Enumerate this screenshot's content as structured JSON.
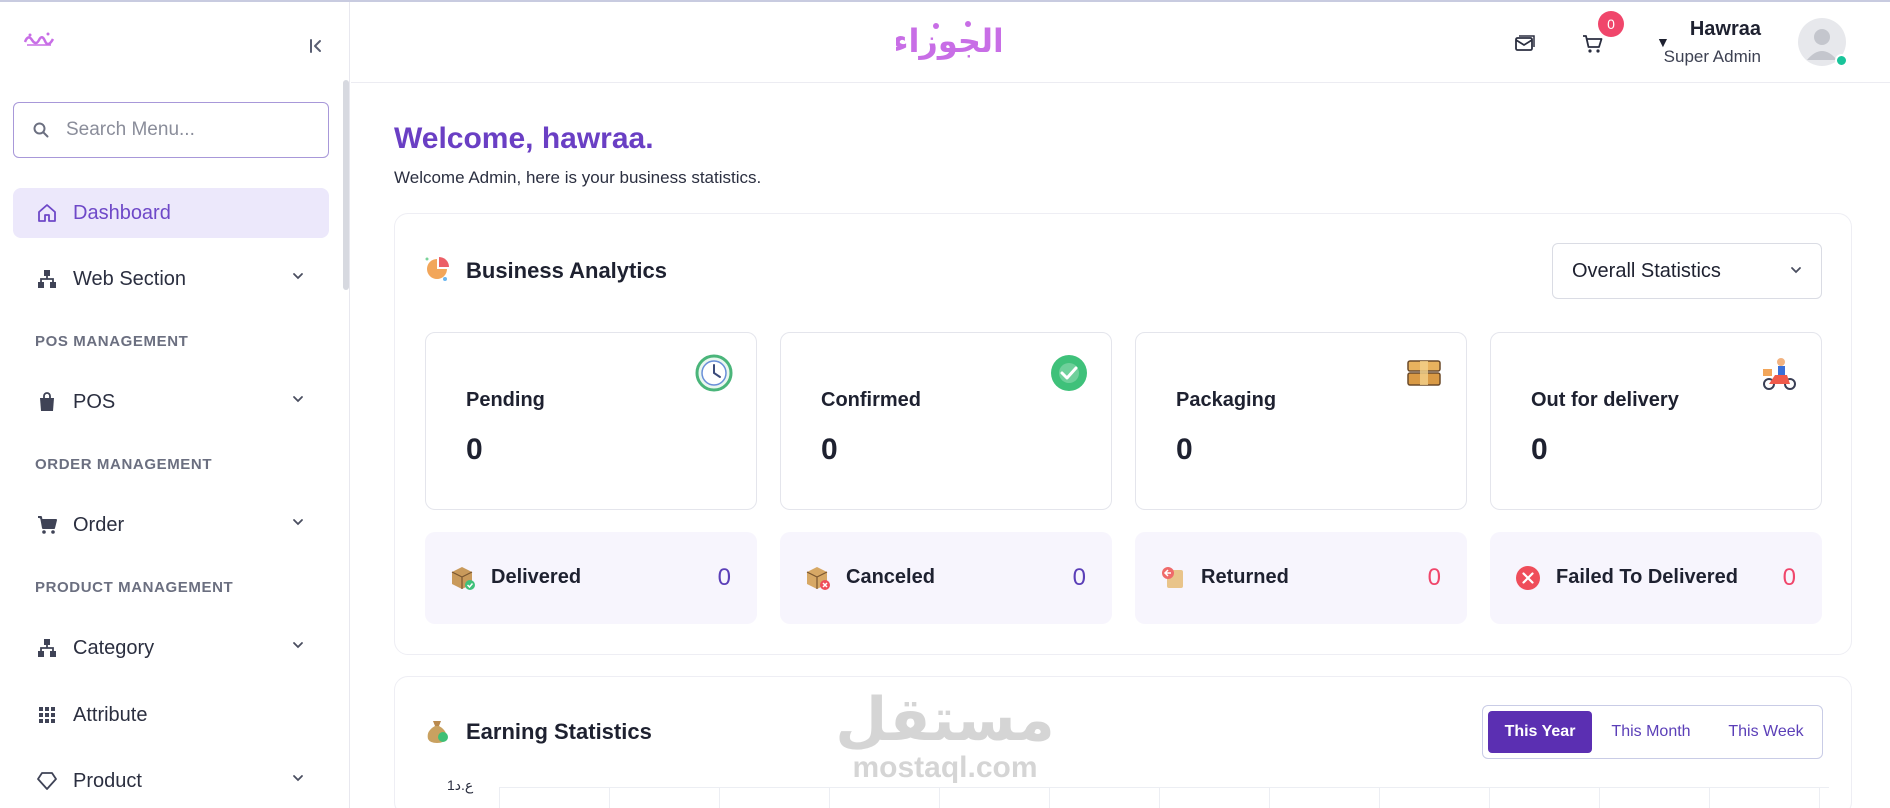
{
  "brand": {
    "logo_text": "الجوزاء",
    "logo_color": "#c86ee6"
  },
  "sidebar": {
    "search_placeholder": "Search Menu...",
    "items": [
      {
        "label": "Dashboard"
      },
      {
        "label": "Web Section"
      },
      {
        "label": "POS"
      },
      {
        "label": "Order"
      },
      {
        "label": "Category"
      },
      {
        "label": "Attribute"
      },
      {
        "label": "Product"
      }
    ],
    "sections": [
      "POS MANAGEMENT",
      "ORDER MANAGEMENT",
      "PRODUCT MANAGEMENT"
    ]
  },
  "header": {
    "cart_count": "0",
    "user_name": "Hawraa",
    "user_role": "Super Admin"
  },
  "welcome": {
    "title": "Welcome, hawraa.",
    "subtitle": "Welcome Admin, here is your business statistics."
  },
  "analytics": {
    "title": "Business Analytics",
    "filter_value": "Overall Statistics",
    "stats": [
      {
        "label": "Pending",
        "value": "0"
      },
      {
        "label": "Confirmed",
        "value": "0"
      },
      {
        "label": "Packaging",
        "value": "0"
      },
      {
        "label": "Out for delivery",
        "value": "0"
      }
    ],
    "mini_stats": [
      {
        "label": "Delivered",
        "value": "0"
      },
      {
        "label": "Canceled",
        "value": "0"
      },
      {
        "label": "Returned",
        "value": "0"
      },
      {
        "label": "Failed To Delivered",
        "value": "0"
      }
    ]
  },
  "earning": {
    "title": "Earning Statistics",
    "tabs": [
      "This Year",
      "This Month",
      "This Week"
    ],
    "axis_tick": "1ع.د"
  },
  "watermark": {
    "arabic": "مستقل",
    "latin": "mostaql.com"
  },
  "colors": {
    "accent": "#6a3fc4",
    "active_bg": "#ece8fb",
    "badge": "#f0466b",
    "online": "#19c49a"
  }
}
